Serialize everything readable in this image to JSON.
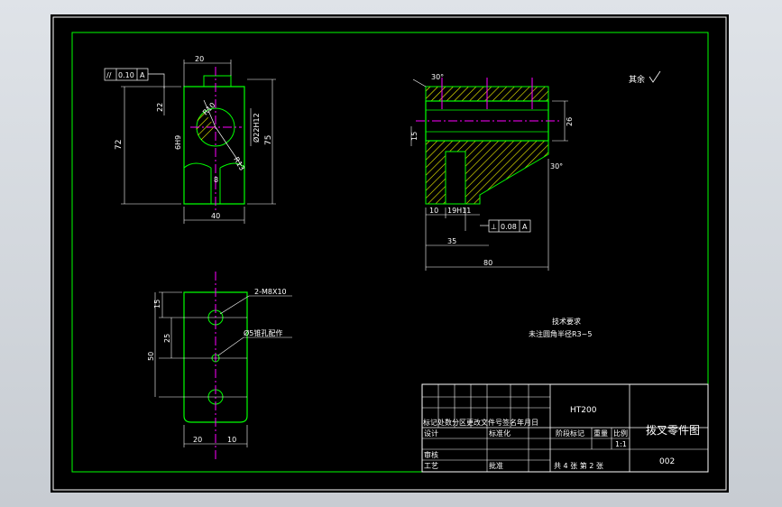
{
  "drawing": {
    "part_name": "拨叉零件图",
    "drawing_no": "002",
    "material": "HT200",
    "remainder_note": "其余",
    "tech_title": "技术要求",
    "tech_note": "未注圆角半径R3~5",
    "scale_value": "1:1",
    "sheet_info": "共 4 张 第 2 张"
  },
  "title_block": {
    "row_header": "标记处数分区更改文件号签名年月日",
    "design": "设计",
    "standardize": "标准化",
    "stage_mark": "阶段标记",
    "weight": "重量",
    "scale": "比例",
    "review": "审核",
    "process": "工艺",
    "approve": "批准"
  },
  "front_view": {
    "dim_top": "20",
    "dim_width": "40",
    "dim_height_left": "72",
    "dim_height_right": "75",
    "dim_22": "22",
    "dim_bore": "Ø22H12",
    "dim_slot": "6H9",
    "dim_r10": "R10",
    "dim_r13": "R13",
    "dim_8": "8",
    "tolerance_symbol": "//",
    "tolerance_value": "0.10",
    "tolerance_datum": "A"
  },
  "side_view": {
    "angle_top": "30°",
    "angle_bottom": "30°",
    "dim_26": "26",
    "dim_15": "15",
    "dim_10": "10",
    "dim_19h11": "19H11",
    "dim_35": "35",
    "dim_80": "80",
    "perp_symbol": "⊥",
    "perp_value": "0.08",
    "perp_datum": "A"
  },
  "bottom_view": {
    "thread_label": "2-M8X10",
    "pin_label": "Ø5锥孔配作",
    "dim_15": "15",
    "dim_25": "25",
    "dim_50": "50",
    "dim_20": "20",
    "dim_10": "10"
  }
}
